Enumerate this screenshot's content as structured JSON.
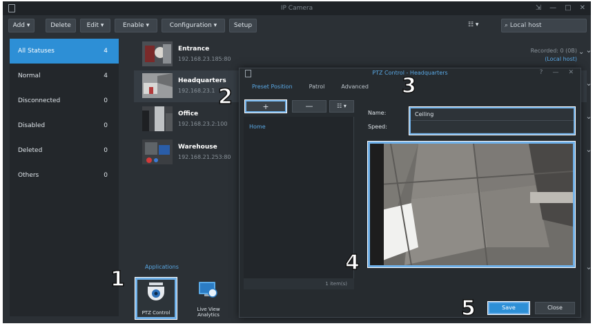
{
  "window": {
    "title": "IP Camera"
  },
  "toolbar": {
    "add": "Add ▾",
    "delete": "Delete",
    "edit": "Edit ▾",
    "enable": "Enable ▾",
    "configuration": "Configuration ▾",
    "setup": "Setup",
    "view": "☷ ▾",
    "search_placeholder": "Local host"
  },
  "sidebar": {
    "items": [
      {
        "label": "All Statuses",
        "count": "4"
      },
      {
        "label": "Normal",
        "count": "4"
      },
      {
        "label": "Disconnected",
        "count": "0"
      },
      {
        "label": "Disabled",
        "count": "0"
      },
      {
        "label": "Deleted",
        "count": "0"
      },
      {
        "label": "Others",
        "count": "0"
      }
    ]
  },
  "cameras": [
    {
      "name": "Entrance",
      "ip": "192.168.23.185:80",
      "status": "Recorded: 0 (0B)",
      "status_link": "(Local host)"
    },
    {
      "name": "Headquarters",
      "ip": "192.168.23.1"
    },
    {
      "name": "Office",
      "ip": "192.168.23.2:100"
    },
    {
      "name": "Warehouse",
      "ip": "192.168.21.253:80"
    }
  ],
  "applications": {
    "label": "Applications",
    "items": [
      {
        "label": "PTZ Control"
      },
      {
        "label": "Live View Analytics"
      }
    ]
  },
  "dialog": {
    "title": "PTZ Control - Headquarters",
    "tabs": [
      "Preset Position",
      "Patrol",
      "Advanced"
    ],
    "add_symbol": "+",
    "remove_symbol": "—",
    "view_symbol": "☷ ▾",
    "preset_item": "Home",
    "preset_count": "1 item(s)",
    "name_label": "Name:",
    "name_value": "Ceiling",
    "speed_label": "Speed:",
    "speed_value": "",
    "save": "Save",
    "close": "Close"
  },
  "steps": [
    "1",
    "2",
    "3",
    "4",
    "5"
  ],
  "colors": {
    "accent": "#2d8fd6",
    "highlight": "#6fb1ea",
    "background": "#2b3035"
  }
}
